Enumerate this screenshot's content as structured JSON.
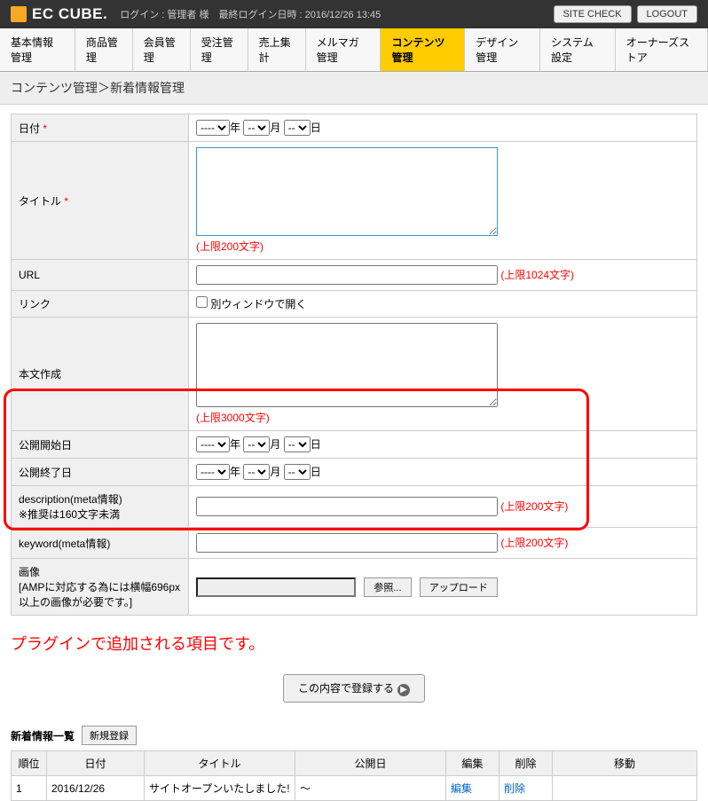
{
  "header": {
    "logo": "EC CUBE.",
    "login_info": "ログイン : 管理者 様　最終ログイン日時 : 2016/12/26 13:45",
    "site_check": "SITE CHECK",
    "logout": "LOGOUT"
  },
  "tabs": [
    "基本情報管理",
    "商品管理",
    "会員管理",
    "受注管理",
    "売上集計",
    "メルマガ管理",
    "コンテンツ管理",
    "デザイン管理",
    "システム設定",
    "オーナーズストア"
  ],
  "breadcrumb": "コンテンツ管理＞新着情報管理",
  "form": {
    "labels": {
      "date": "日付",
      "title": "タイトル",
      "url": "URL",
      "link": "リンク",
      "body": "本文作成",
      "pub_start": "公開開始日",
      "pub_end": "公開終了日",
      "description": "description(meta情報)",
      "description_sub": "※推奨は160文字未満",
      "keyword": "keyword(meta情報)",
      "image": "画像",
      "image_sub": "[AMPに対応する為には横幅696px以上の画像が必要です。]"
    },
    "date_unit": {
      "y": "年",
      "m": "月",
      "d": "日"
    },
    "select_blank": "----",
    "select_blank_s": "--",
    "notes": {
      "title": "(上限200文字)",
      "url": "(上限1024文字)",
      "body": "(上限3000文字)",
      "desc": "(上限200文字)",
      "keyword": "(上限200文字)"
    },
    "link_checkbox": "別ウィンドウで開く",
    "browse": "参照...",
    "upload": "アップロード",
    "submit": "この内容で登録する"
  },
  "annotation": "プラグインで追加される項目です。",
  "list": {
    "heading": "新着情報一覧",
    "new_btn": "新規登録",
    "headers": [
      "順位",
      "日付",
      "タイトル",
      "公開日",
      "編集",
      "削除",
      "移動"
    ],
    "rows": [
      {
        "rank": "1",
        "date": "2016/12/26",
        "title": "サイトオープンいたしました!",
        "pub": "～",
        "edit": "編集",
        "del": "削除",
        "move": ""
      }
    ]
  }
}
